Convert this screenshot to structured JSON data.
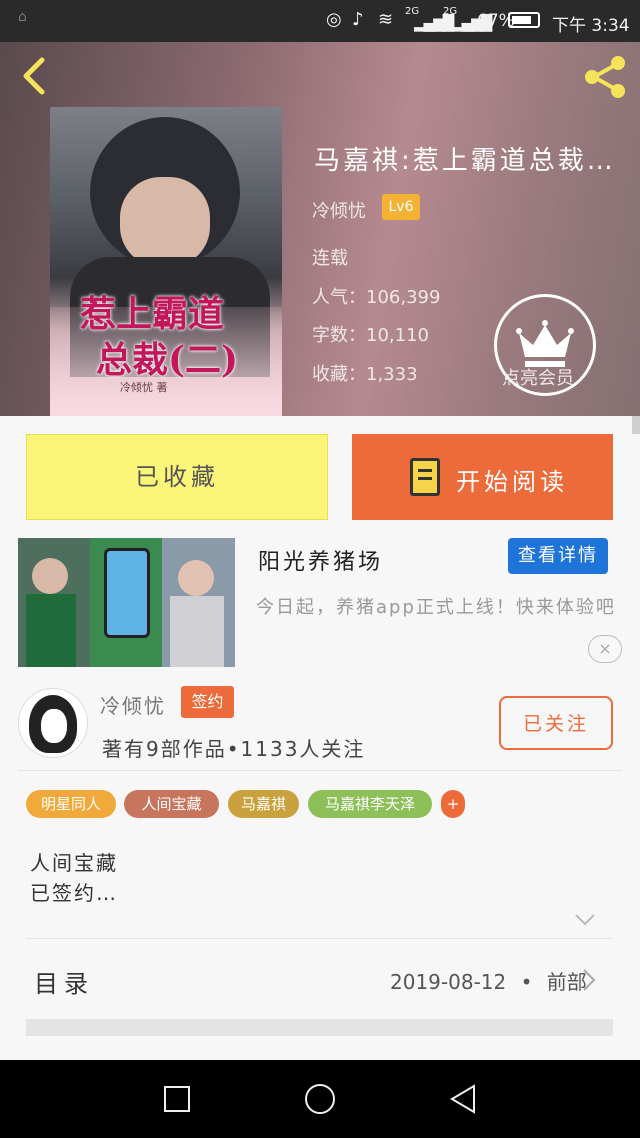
{
  "status_bar": {
    "battery_percent": "67%",
    "time": "下午 3:34",
    "signal_1": "2G",
    "signal_2": "2G"
  },
  "book": {
    "title": "马嘉祺:惹上霸道总裁…",
    "author": "冷倾忧",
    "author_level": "Lv6",
    "status": "连载",
    "popularity_label": "人气：",
    "popularity": "106,399",
    "word_count_label": "字数：",
    "word_count": "10,110",
    "favorites_label": "收藏：",
    "favorites": "1,333",
    "cover_title_line1": "惹上霸道",
    "cover_title_line2": "总裁(二)",
    "cover_author": "冷倾忧 著"
  },
  "vip": {
    "label": "点亮会员"
  },
  "actions": {
    "collected_label": "已收藏",
    "read_label": "开始阅读"
  },
  "ad": {
    "title": "阳光养猪场",
    "detail_button": "查看详情",
    "description": "今日起，养猪app正式上线！快来体验吧",
    "close": "×"
  },
  "author_card": {
    "name": "冷倾忧",
    "signed_badge": "签约",
    "stats": "著有9部作品•1133人关注",
    "follow_label": "已关注"
  },
  "tags": [
    {
      "label": "明星同人",
      "color": "#f2a93b"
    },
    {
      "label": "人间宝藏",
      "color": "#c8755d"
    },
    {
      "label": "马嘉祺",
      "color": "#c9a23d"
    },
    {
      "label": "马嘉祺李天泽",
      "color": "#8ec05a"
    },
    {
      "label": "+",
      "color": "#ed6b3a"
    }
  ],
  "description": {
    "line1": "人间宝藏",
    "line2": "已签约…"
  },
  "toc": {
    "label": "目录",
    "date": "2019-08-12",
    "position": "前部"
  },
  "colors": {
    "accent": "#ed6b3a",
    "collected_bg": "#fbf57a",
    "ad_button": "#1e74d8"
  }
}
